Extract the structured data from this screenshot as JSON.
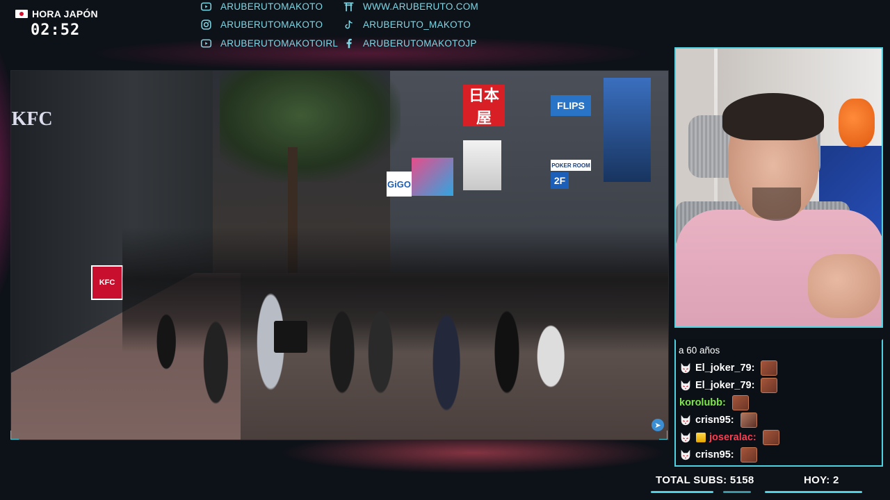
{
  "clock": {
    "label": "HORA JAPÓN",
    "time": "02:52"
  },
  "socials": [
    {
      "icon": "youtube-icon",
      "text": "ARUBERUTOMAKOTO"
    },
    {
      "icon": "instagram-icon",
      "text": "ARUBERUTOMAKOTO"
    },
    {
      "icon": "youtube-icon",
      "text": "ARUBERUTOMAKOTOIRL"
    },
    {
      "icon": "torii-gate-icon",
      "text": "WWW.ARUBERUTO.COM"
    },
    {
      "icon": "tiktok-icon",
      "text": "ARUBERUTO_MAKOTO"
    },
    {
      "icon": "facebook-icon",
      "text": "ARUBERUTOMAKOTOJP"
    }
  ],
  "video": {
    "signs": [
      "KFC",
      "日本屋",
      "GiGO",
      "FLIPS",
      "POKER ROOM",
      "2F"
    ]
  },
  "chat": {
    "continuation": "a 60 años",
    "messages": [
      {
        "user": "El_joker_79:",
        "color": "#ffffff",
        "badge": "kitsune-mask-icon"
      },
      {
        "user": "El_joker_79:",
        "color": "#ffffff",
        "badge": "kitsune-mask-icon"
      },
      {
        "user": "korolubb:",
        "color": "#7ee84a",
        "badge": ""
      },
      {
        "user": "crisn95:",
        "color": "#ffffff",
        "badge": "kitsune-mask-icon"
      },
      {
        "user": "joseralac:",
        "color": "#ff3b4e",
        "badge": "kitsune-mask-icon"
      },
      {
        "user": "crisn95:",
        "color": "#ffffff",
        "badge": "kitsune-mask-icon"
      }
    ]
  },
  "stats": {
    "total_subs": "TOTAL SUBS: 5158",
    "today": "HOY: 2"
  },
  "colors": {
    "accent": "#4fd3e2",
    "social_text": "#7fd8e6",
    "pink_glow": "#eb288c"
  }
}
